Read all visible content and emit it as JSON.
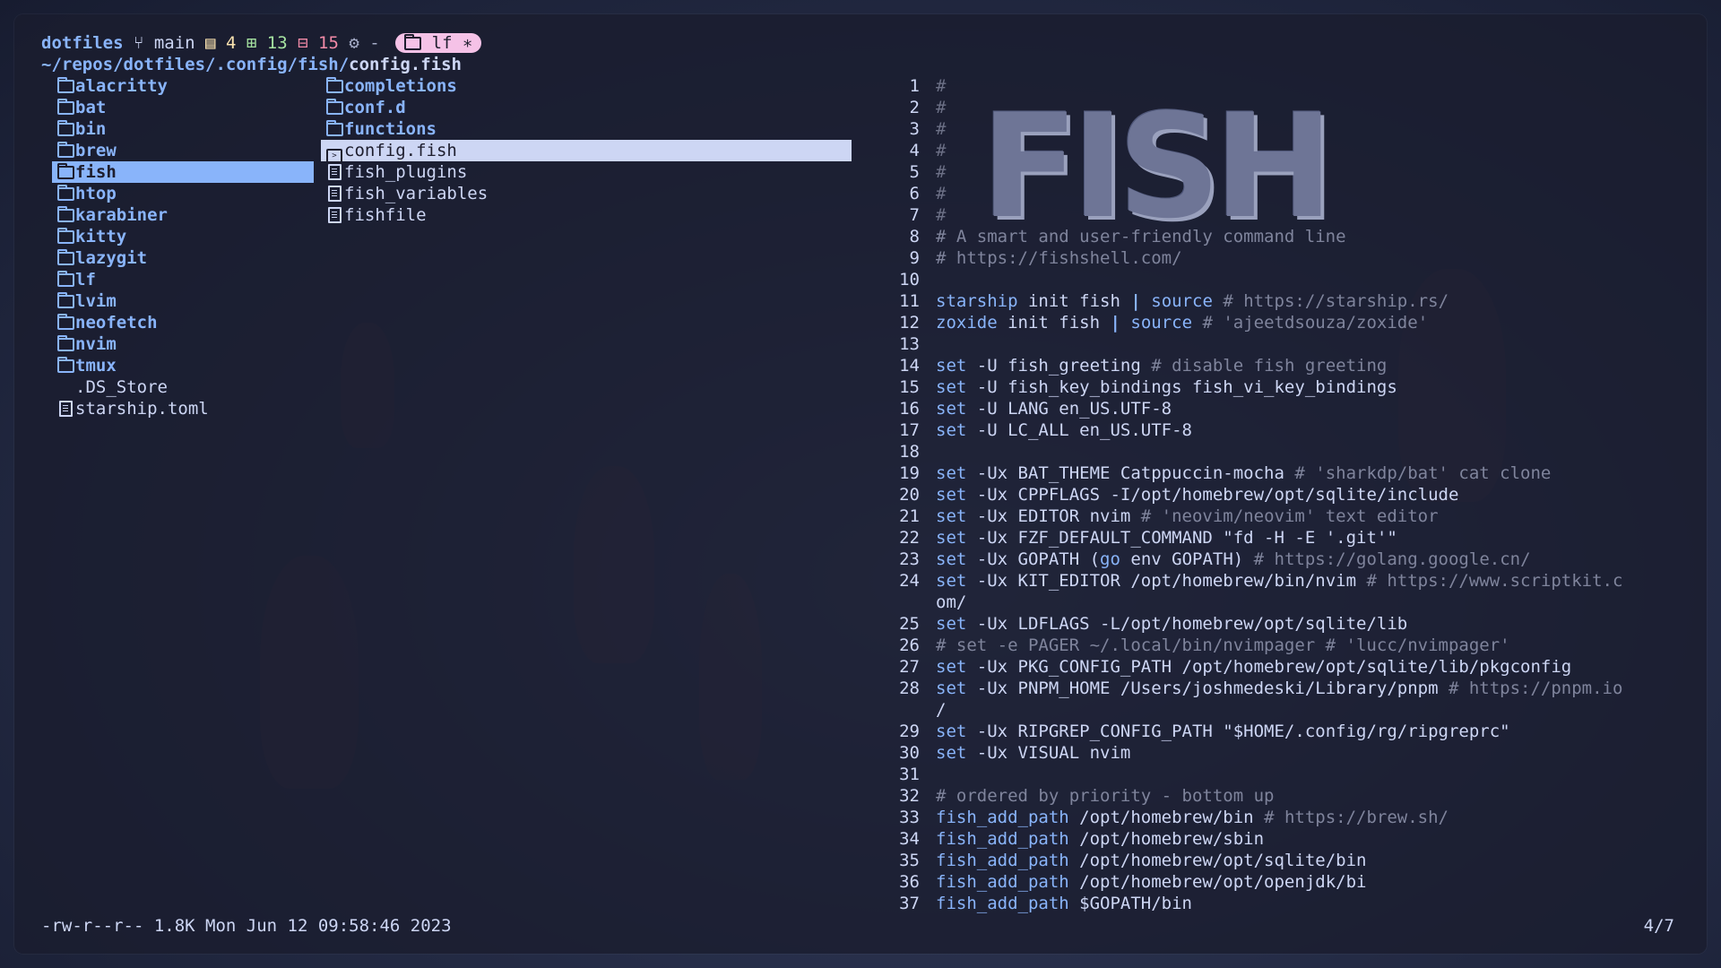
{
  "prompt": {
    "repo": "dotfiles",
    "branch_icon": "git-branch-icon",
    "branch": "main",
    "staged_icon": "clipboard-icon",
    "staged": "4",
    "added_icon": "plus-square-icon",
    "added": "13",
    "removed_icon": "minus-square-icon",
    "removed": "15",
    "sep": "-",
    "badge": "lf ∗"
  },
  "path": {
    "dir": "~/repos/dotfiles/.config/fish/",
    "file": "config.fish"
  },
  "parent_list": [
    {
      "name": "alacritty",
      "kind": "dir",
      "icon": "folder-icon"
    },
    {
      "name": "bat",
      "kind": "dir",
      "icon": "folder-icon"
    },
    {
      "name": "bin",
      "kind": "dir",
      "icon": "folder-icon"
    },
    {
      "name": "brew",
      "kind": "dir",
      "icon": "folder-icon"
    },
    {
      "name": "fish",
      "kind": "dir",
      "icon": "folder-icon",
      "selected": true
    },
    {
      "name": "htop",
      "kind": "dir",
      "icon": "folder-icon"
    },
    {
      "name": "karabiner",
      "kind": "dir",
      "icon": "folder-icon"
    },
    {
      "name": "kitty",
      "kind": "dir",
      "icon": "folder-icon"
    },
    {
      "name": "lazygit",
      "kind": "dir",
      "icon": "folder-icon"
    },
    {
      "name": "lf",
      "kind": "dir",
      "icon": "folder-icon"
    },
    {
      "name": "lvim",
      "kind": "dir",
      "icon": "folder-icon"
    },
    {
      "name": "neofetch",
      "kind": "dir",
      "icon": "folder-icon"
    },
    {
      "name": "nvim",
      "kind": "dir",
      "icon": "folder-icon"
    },
    {
      "name": "tmux",
      "kind": "dir",
      "icon": "folder-icon"
    },
    {
      "name": ".DS_Store",
      "kind": "file",
      "icon": "apple-icon"
    },
    {
      "name": "starship.toml",
      "kind": "file",
      "icon": "file-icon"
    }
  ],
  "current_list": [
    {
      "name": "completions",
      "kind": "dir",
      "icon": "folder-icon"
    },
    {
      "name": "conf.d",
      "kind": "dir",
      "icon": "folder-icon"
    },
    {
      "name": "functions",
      "kind": "dir",
      "icon": "folder-icon"
    },
    {
      "name": "config.fish",
      "kind": "file",
      "icon": "terminal-icon",
      "selected": true
    },
    {
      "name": "fish_plugins",
      "kind": "file",
      "icon": "file-icon"
    },
    {
      "name": "fish_variables",
      "kind": "file",
      "icon": "file-icon"
    },
    {
      "name": "fishfile",
      "kind": "file",
      "icon": "file-icon"
    }
  ],
  "preview": {
    "banner_text": "FISH",
    "lines": [
      {
        "n": "1",
        "t": "#"
      },
      {
        "n": "2",
        "t": "#"
      },
      {
        "n": "3",
        "t": "#"
      },
      {
        "n": "4",
        "t": "#"
      },
      {
        "n": "5",
        "t": "#"
      },
      {
        "n": "6",
        "t": "#"
      },
      {
        "n": "7",
        "t": "#"
      },
      {
        "n": "8",
        "t": "# A smart and user-friendly command line"
      },
      {
        "n": "9",
        "t": "# https://fishshell.com/"
      },
      {
        "n": "10",
        "t": ""
      },
      {
        "n": "11",
        "t": "starship init fish | source # https://starship.rs/"
      },
      {
        "n": "12",
        "t": "zoxide init fish | source # 'ajeetdsouza/zoxide'"
      },
      {
        "n": "13",
        "t": ""
      },
      {
        "n": "14",
        "t": "set -U fish_greeting # disable fish greeting"
      },
      {
        "n": "15",
        "t": "set -U fish_key_bindings fish_vi_key_bindings"
      },
      {
        "n": "16",
        "t": "set -U LANG en_US.UTF-8"
      },
      {
        "n": "17",
        "t": "set -U LC_ALL en_US.UTF-8"
      },
      {
        "n": "18",
        "t": ""
      },
      {
        "n": "19",
        "t": "set -Ux BAT_THEME Catppuccin-mocha # 'sharkdp/bat' cat clone"
      },
      {
        "n": "20",
        "t": "set -Ux CPPFLAGS -I/opt/homebrew/opt/sqlite/include"
      },
      {
        "n": "21",
        "t": "set -Ux EDITOR nvim # 'neovim/neovim' text editor"
      },
      {
        "n": "22",
        "t": "set -Ux FZF_DEFAULT_COMMAND \"fd -H -E '.git'\""
      },
      {
        "n": "23",
        "t": "set -Ux GOPATH (go env GOPATH) # https://golang.google.cn/"
      },
      {
        "n": "24",
        "t": "set -Ux KIT_EDITOR /opt/homebrew/bin/nvim # https://www.scriptkit.c"
      },
      {
        "n": "",
        "t": "om/"
      },
      {
        "n": "25",
        "t": "set -Ux LDFLAGS -L/opt/homebrew/opt/sqlite/lib"
      },
      {
        "n": "26",
        "t": "# set -e PAGER ~/.local/bin/nvimpager # 'lucc/nvimpager'"
      },
      {
        "n": "27",
        "t": "set -Ux PKG_CONFIG_PATH /opt/homebrew/opt/sqlite/lib/pkgconfig"
      },
      {
        "n": "28",
        "t": "set -Ux PNPM_HOME /Users/joshmedeski/Library/pnpm # https://pnpm.io"
      },
      {
        "n": "",
        "t": "/"
      },
      {
        "n": "29",
        "t": "set -Ux RIPGREP_CONFIG_PATH \"$HOME/.config/rg/ripgreprc\""
      },
      {
        "n": "30",
        "t": "set -Ux VISUAL nvim"
      },
      {
        "n": "31",
        "t": ""
      },
      {
        "n": "32",
        "t": "# ordered by priority - bottom up"
      },
      {
        "n": "33",
        "t": "fish_add_path /opt/homebrew/bin # https://brew.sh/"
      },
      {
        "n": "34",
        "t": "fish_add_path /opt/homebrew/sbin"
      },
      {
        "n": "35",
        "t": "fish_add_path /opt/homebrew/opt/sqlite/bin"
      },
      {
        "n": "36",
        "t": "fish_add_path /opt/homebrew/opt/openjdk/bi"
      },
      {
        "n": "37",
        "t": "fish_add_path $GOPATH/bin"
      }
    ]
  },
  "status": {
    "info": "-rw-r--r-- 1.8K Mon Jun 12 09:58:46 2023",
    "pager": "4/7"
  },
  "colors": {
    "accent": "#89b4fa",
    "badge": "#f5c2e7",
    "comment": "#7f849c",
    "text": "#cdd6f4"
  }
}
